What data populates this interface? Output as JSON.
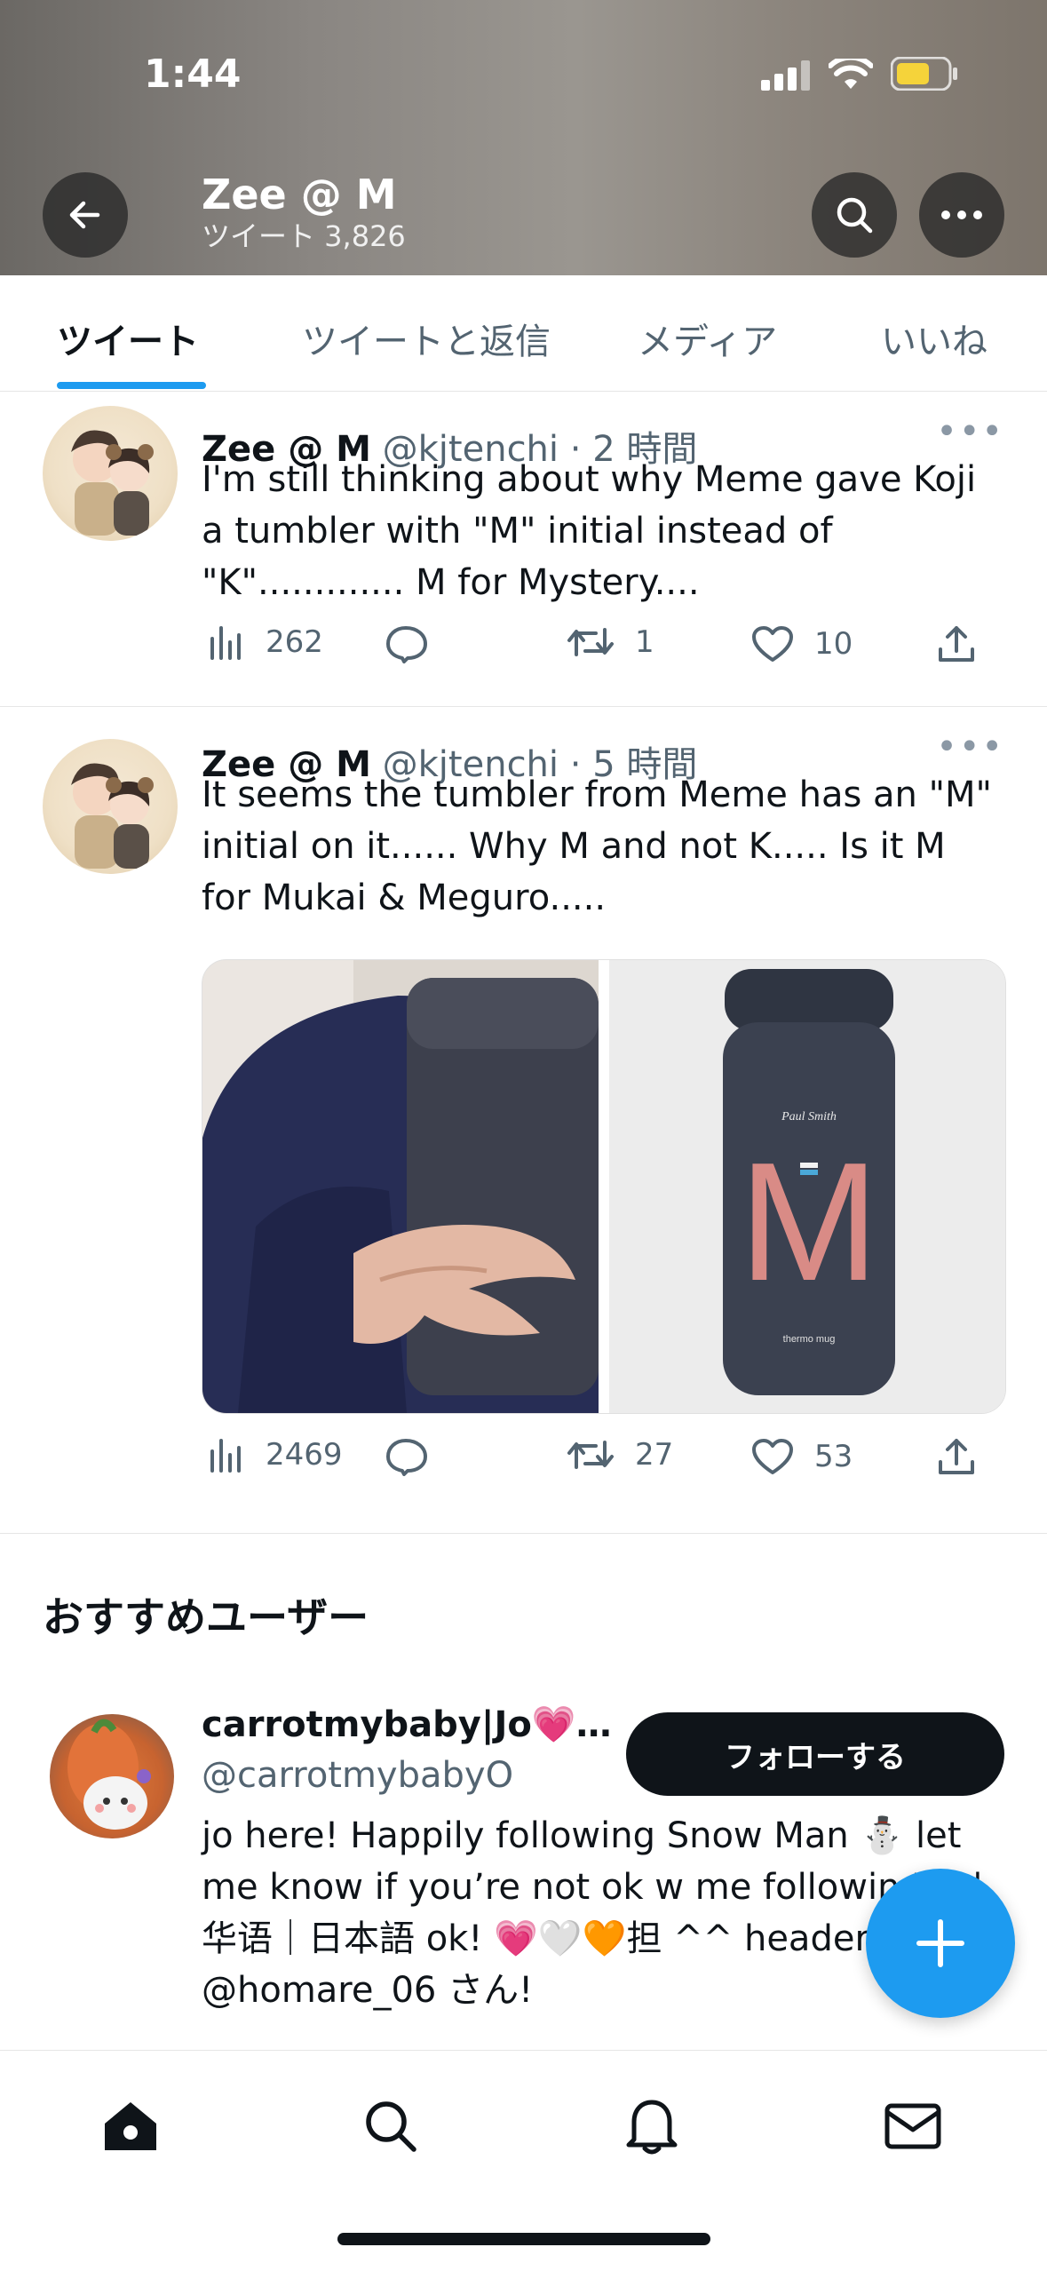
{
  "status_bar": {
    "time": "1:44"
  },
  "profile_header": {
    "title": "Zee @ M",
    "tweet_count": "ツイート 3,826"
  },
  "tabs": [
    {
      "label": "ツイート",
      "active": true
    },
    {
      "label": "ツイートと返信",
      "active": false
    },
    {
      "label": "メディア",
      "active": false
    },
    {
      "label": "いいね",
      "active": false
    }
  ],
  "tweets": [
    {
      "name": "Zee @ M",
      "handle": "@kjtenchi",
      "time": "2 時間",
      "text": "I'm still thinking about why Meme gave Koji a tumbler with \"M\" initial instead of \"K\"............. M for Mystery....",
      "views": "262",
      "replies": "",
      "retweets": "1",
      "likes": "10"
    },
    {
      "name": "Zee @ M",
      "handle": "@kjtenchi",
      "time": "5 時間",
      "text": "It seems the tumbler from Meme has an \"M\" initial on it...... Why M and not K..... Is it M for Mukai & Meguro.....",
      "views": "2469",
      "replies": "",
      "retweets": "27",
      "likes": "53",
      "media": {
        "bottle_brand": "Paul Smith",
        "bottle_letter": "M",
        "bottle_small": "thermo mug"
      }
    }
  ],
  "suggestions": {
    "title": "おすすめユーザー",
    "user": {
      "name": "carrotmybaby|Jo💗…",
      "handle": "@carrotmybabyO",
      "follow_label": "フォローする",
      "bio": "jo here! Happily following Snow Man ⛄ let me know if you’re not ok w me followin EN | 华语｜日本語 ok! 💗🤍🧡担 ^^ header by @homare_06 さん!"
    }
  },
  "colors": {
    "accent": "#1d9bf0",
    "text": "#0f1419",
    "muted": "#536471"
  },
  "icons": {
    "back": "arrow-left-icon",
    "search": "search-icon",
    "more": "more-icon",
    "views": "bar-chart-icon",
    "reply": "reply-icon",
    "retweet": "retweet-icon",
    "like": "heart-icon",
    "share": "share-icon",
    "compose": "plus-icon",
    "nav": [
      "home-icon",
      "search-icon",
      "bell-icon",
      "mail-icon"
    ]
  }
}
